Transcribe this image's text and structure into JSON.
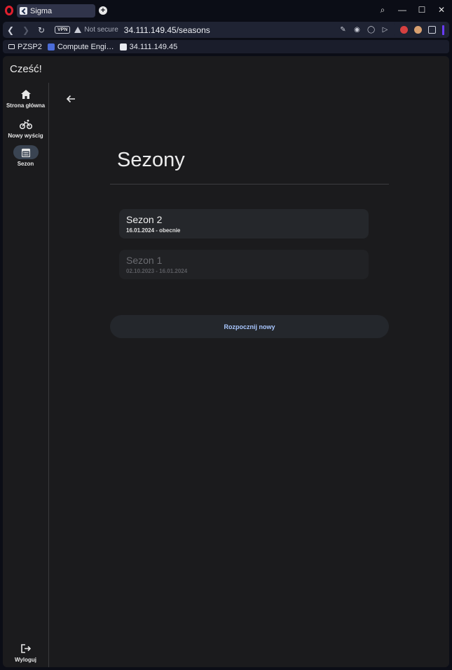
{
  "browser": {
    "tab_title": "Sigma",
    "new_tab": "+",
    "vpn_badge": "VPN",
    "not_secure": "Not secure",
    "url": "34.111.149.45/seasons",
    "window_controls": {
      "search": "⌕",
      "minimize": "—",
      "maximize": "☐",
      "close": "✕"
    },
    "bookmarks": [
      {
        "label": "PZSP2",
        "icon": "folder-icon"
      },
      {
        "label": "Compute Engi…",
        "icon": "globe-icon"
      },
      {
        "label": "34.111.149.45",
        "icon": "app-icon"
      }
    ]
  },
  "app": {
    "greeting": "Cześć!",
    "nav": [
      {
        "label": "Strona główna",
        "icon": "home-icon",
        "active": false
      },
      {
        "label": "Nowy wyścig",
        "icon": "bicycle-icon",
        "active": false
      },
      {
        "label": "Sezon",
        "icon": "calendar-icon",
        "active": true
      }
    ],
    "logout": {
      "label": "Wyloguj",
      "icon": "logout-icon"
    },
    "title": "Sezony",
    "seasons": [
      {
        "name": "Sezon 2",
        "dates": "16.01.2024 - obecnie"
      },
      {
        "name": "Sezon 1",
        "dates": "02.10.2023 - 16.01.2024"
      }
    ],
    "start_new": "Rozpocznij nowy"
  },
  "colors": {
    "background": "#1b1b1d",
    "card": "#25272b",
    "accent_text": "#a9c7ff",
    "active_nav": "#3a4452"
  }
}
